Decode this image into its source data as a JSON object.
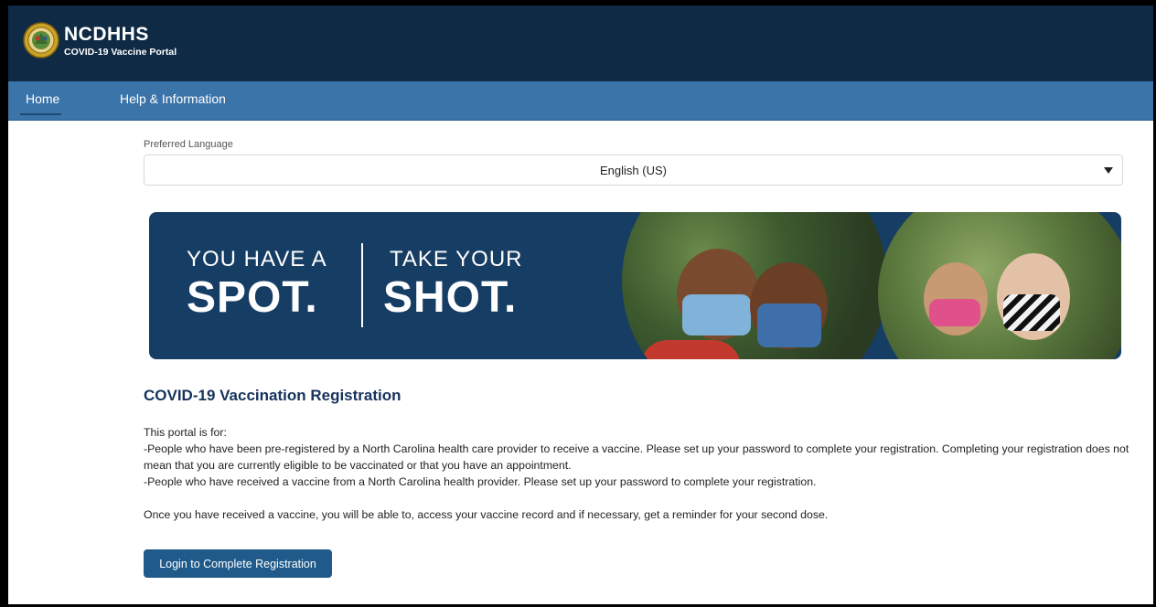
{
  "header": {
    "brand_title": "NCDHHS",
    "brand_subtitle": "COVID-19 Vaccine Portal",
    "logo_icon": "nc-state-seal-icon",
    "background_color": "#0f2a45"
  },
  "nav": {
    "items": [
      {
        "label": "Home",
        "active": true
      },
      {
        "label": "Help & Information",
        "active": false
      }
    ],
    "background_color": "#3b74a8"
  },
  "language": {
    "label": "Preferred Language",
    "selected": "English (US)",
    "caret_icon": "caret-down-icon"
  },
  "banner": {
    "left_line1": "YOU HAVE A",
    "left_line2": "SPOT.",
    "right_line1": "TAKE YOUR",
    "right_line2": "SHOT.",
    "background_color": "#163d63"
  },
  "registration": {
    "title": "COVID-19 Vaccination Registration",
    "intro": "This portal is for:",
    "line1": "-People who have been pre-registered by a North Carolina health care provider to receive a vaccine. Please set up your password to complete your registration. Completing your registration does not mean that you are currently eligible to be vaccinated or that you have an appointment.",
    "line2": "-People who have received a vaccine from a North Carolina health provider. Please set up your password to complete your registration.",
    "line3": "Once you have received a vaccine, you will be able to, access your vaccine record and if necessary, get a reminder for your second dose.",
    "button_label": "Login to Complete Registration",
    "accent_color": "#16325c"
  }
}
